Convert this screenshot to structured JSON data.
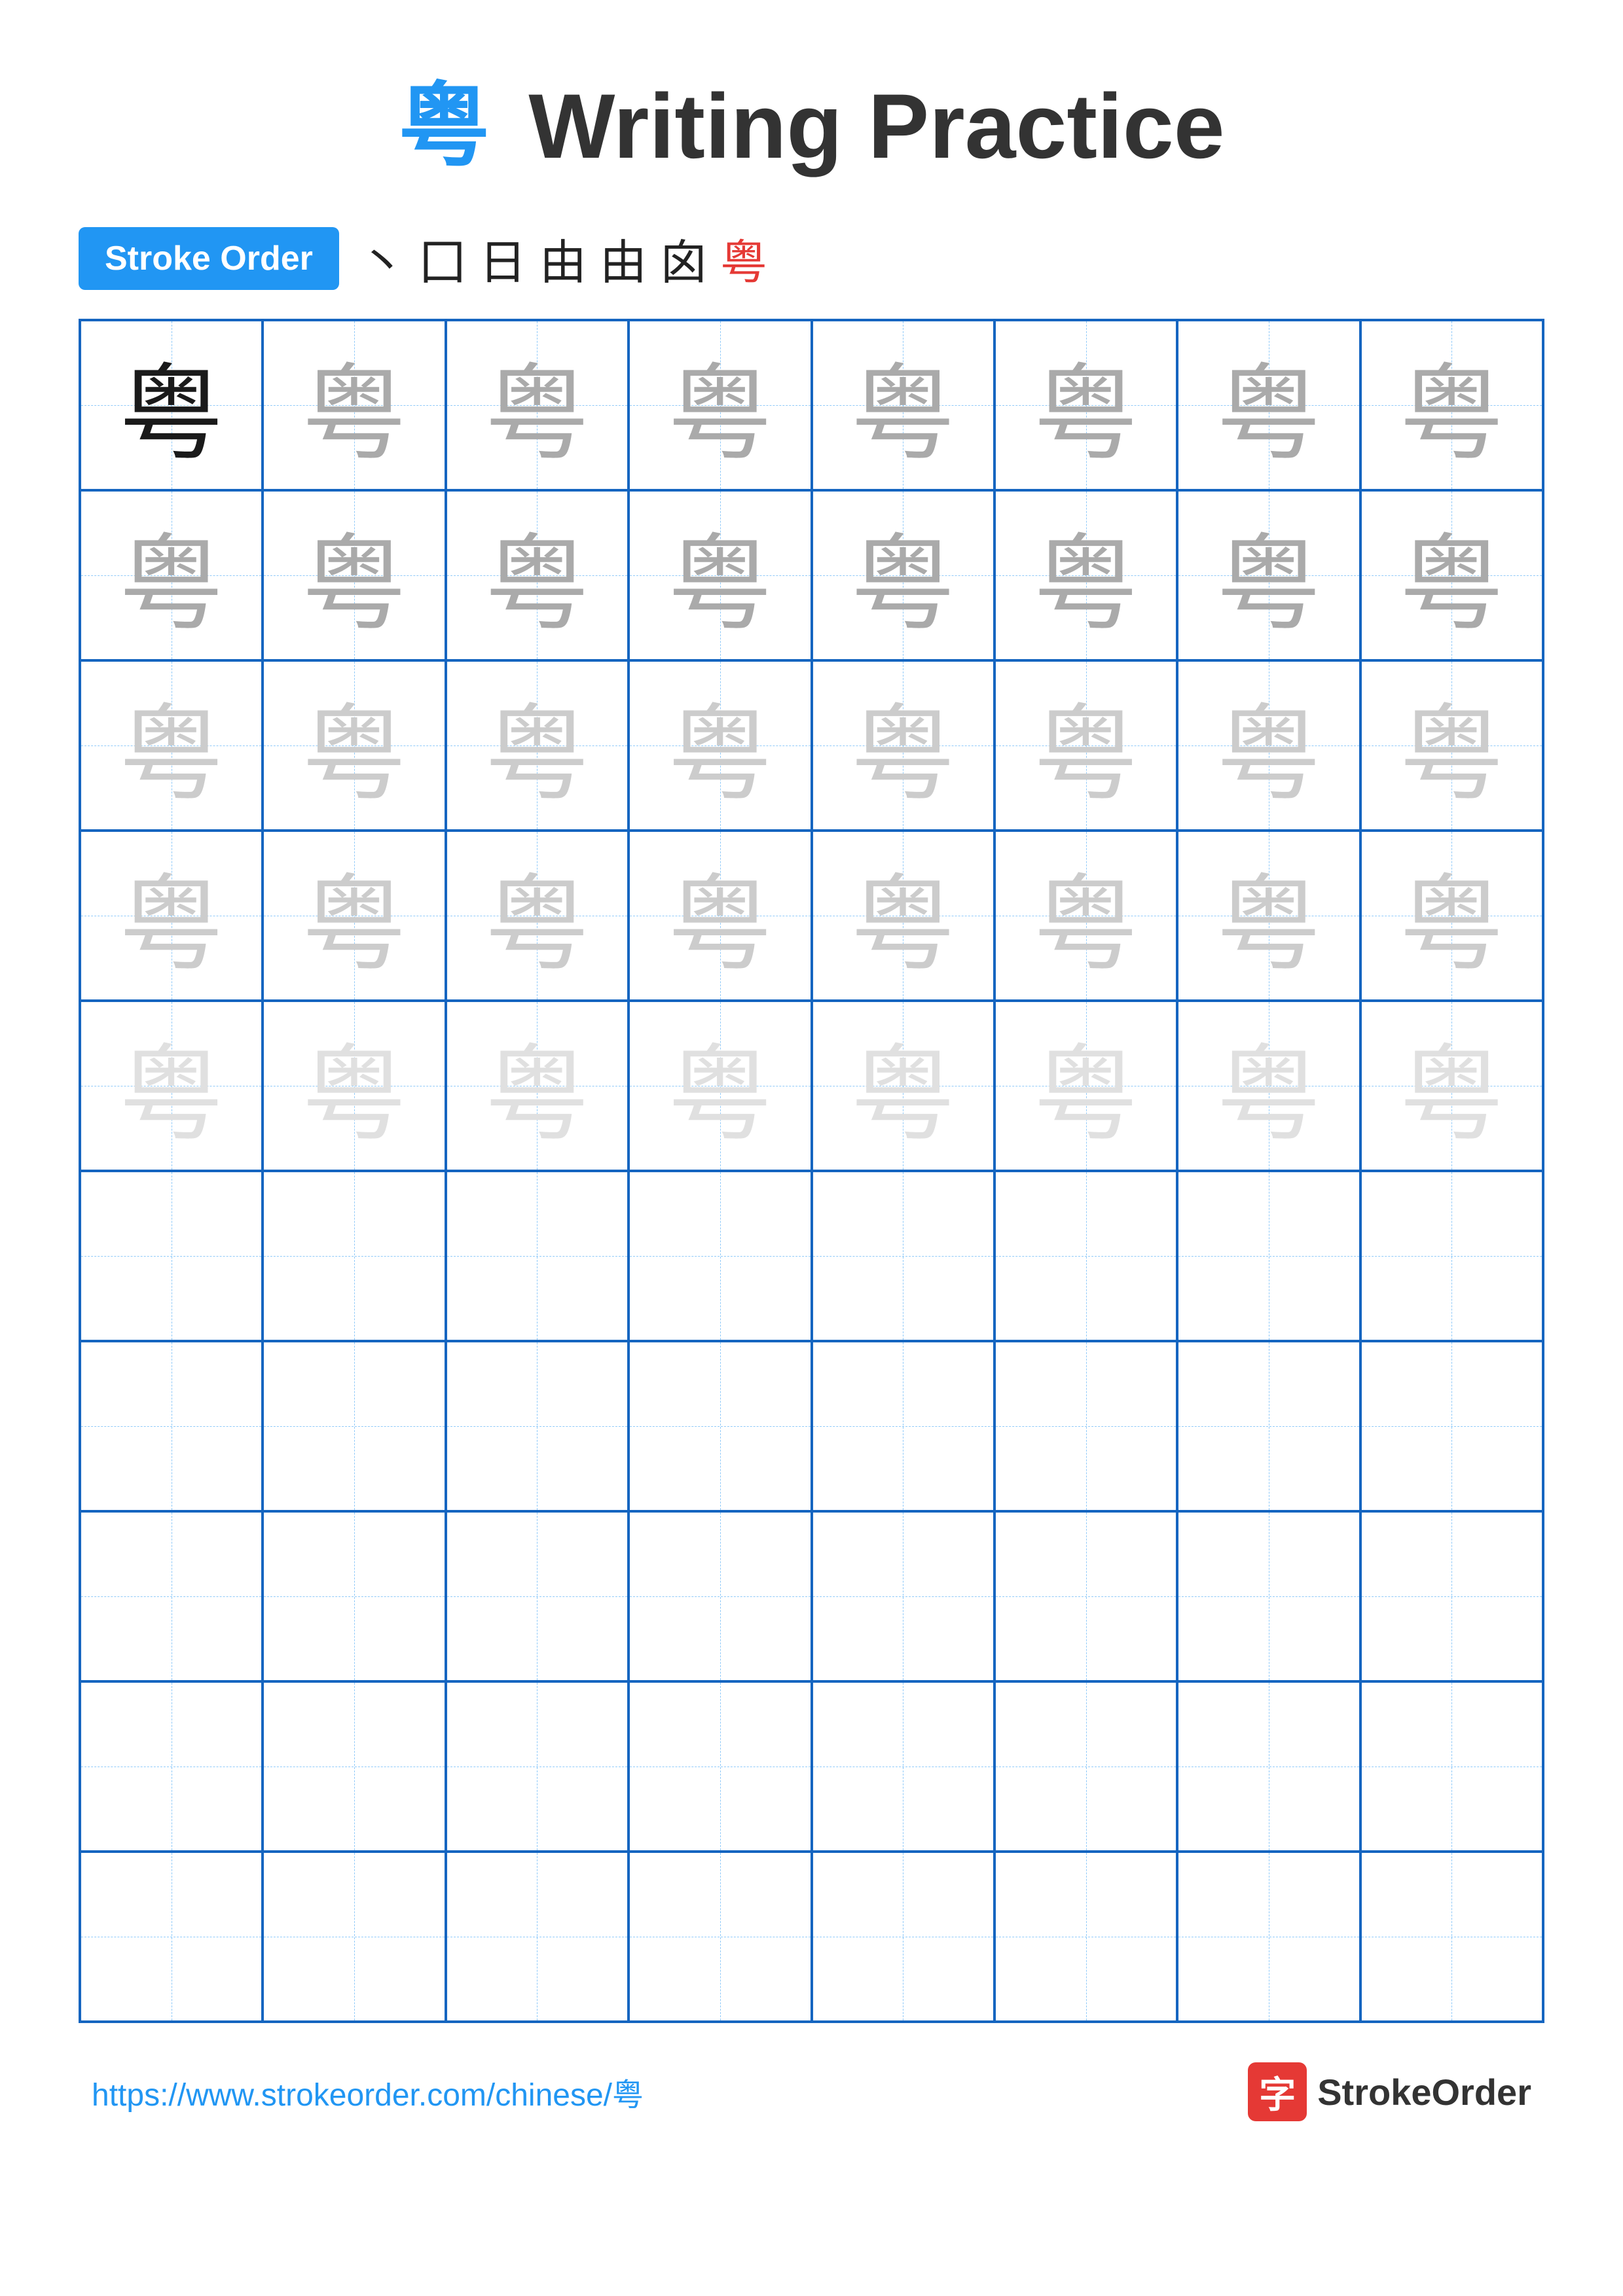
{
  "title": {
    "char": "粤",
    "text": "Writing Practice"
  },
  "stroke_order": {
    "badge_label": "Stroke Order",
    "steps": [
      "丶",
      "囗",
      "日",
      "由",
      "由",
      "囟",
      "粤"
    ]
  },
  "grid": {
    "rows": 10,
    "cols": 8,
    "char": "粤",
    "filled_rows": 5
  },
  "footer": {
    "url": "https://www.strokeorder.com/chinese/粤",
    "logo_char": "字",
    "logo_text": "StrokeOrder"
  }
}
